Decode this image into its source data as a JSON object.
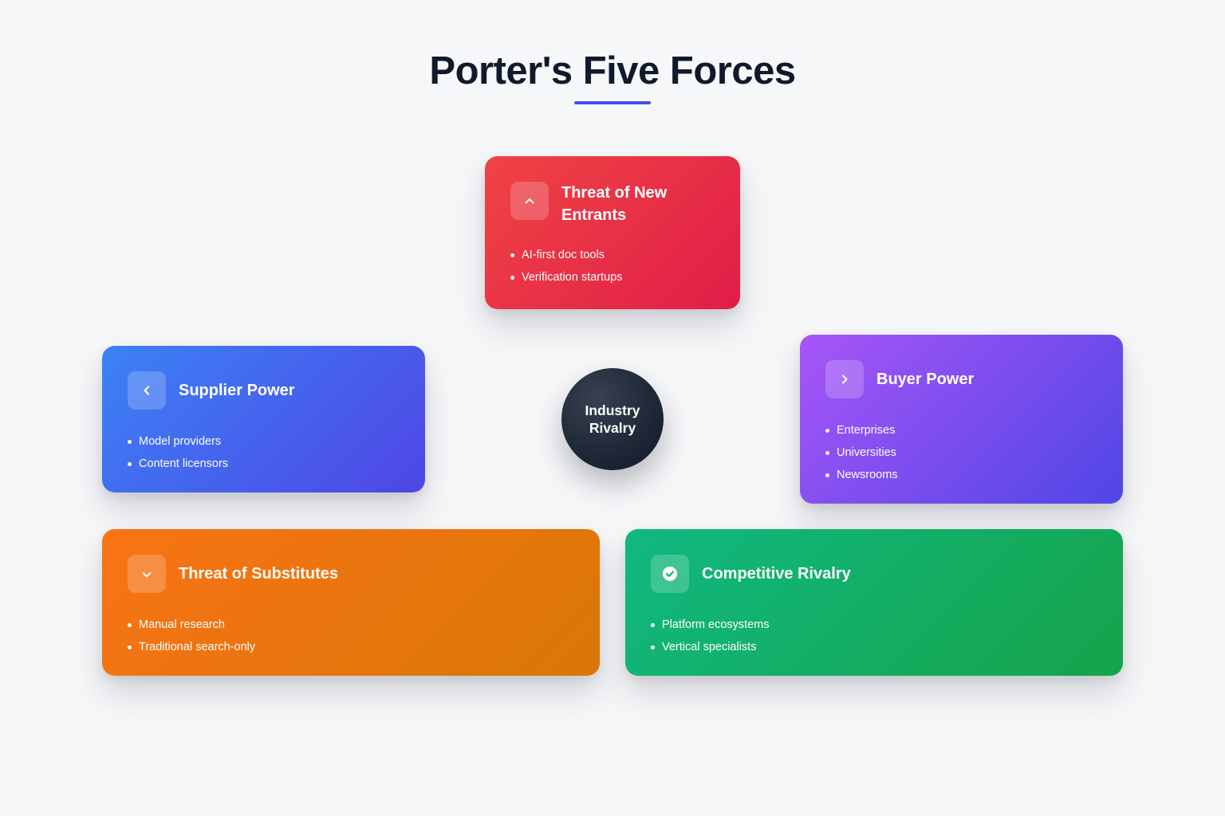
{
  "header": {
    "title": "Porter's Five Forces"
  },
  "hub": {
    "label": "Industry Rivalry"
  },
  "forces": {
    "new_entrants": {
      "title": "Threat of New Entrants",
      "icon": "chevron-up-icon",
      "items": [
        "AI-first doc tools",
        "Verification startups"
      ]
    },
    "supplier_power": {
      "title": "Supplier Power",
      "icon": "chevron-left-icon",
      "items": [
        "Model providers",
        "Content licensors"
      ]
    },
    "buyer_power": {
      "title": "Buyer Power",
      "icon": "chevron-right-icon",
      "items": [
        "Enterprises",
        "Universities",
        "Newsrooms"
      ]
    },
    "substitutes": {
      "title": "Threat of Substitutes",
      "icon": "chevron-down-icon",
      "items": [
        "Manual research",
        "Traditional search-only"
      ]
    },
    "competitive_rivalry": {
      "title": "Competitive Rivalry",
      "icon": "check-circle-icon",
      "items": [
        "Platform ecosystems",
        "Vertical specialists"
      ]
    }
  },
  "colors": {
    "title_text": "#111a2b",
    "title_underline": "#4350e6",
    "new_entrants": [
      "#ef4444",
      "#e11d48"
    ],
    "supplier_power": [
      "#3b82f6",
      "#4f46e5"
    ],
    "buyer_power": [
      "#a855f7",
      "#4f46e5"
    ],
    "substitutes": [
      "#f97316",
      "#d97706"
    ],
    "competitive_rivalry": [
      "#10b981",
      "#16a34a"
    ],
    "hub": "#1f2937"
  }
}
